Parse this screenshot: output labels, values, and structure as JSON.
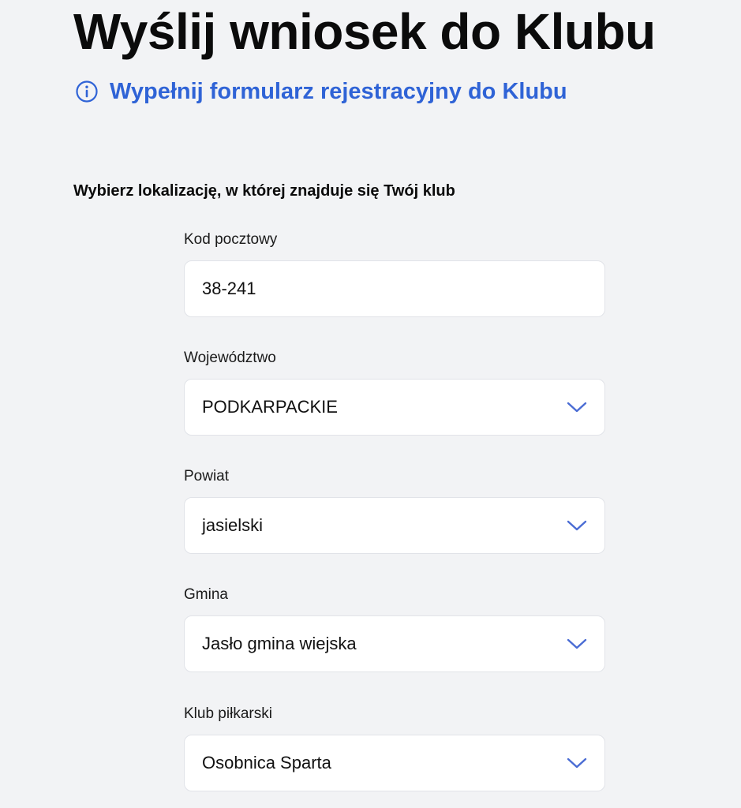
{
  "page": {
    "title": "Wyślij wniosek do Klubu",
    "info_link": "Wypełnij formularz rejestracyjny do Klubu",
    "section_heading": "Wybierz lokalizację, w której znajduje się Twój klub"
  },
  "form": {
    "postal_code": {
      "label": "Kod pocztowy",
      "value": "38-241"
    },
    "voivodeship": {
      "label": "Województwo",
      "value": "PODKARPACKIE"
    },
    "county": {
      "label": "Powiat",
      "value": "jasielski"
    },
    "municipality": {
      "label": "Gmina",
      "value": "Jasło gmina wiejska"
    },
    "club": {
      "label": "Klub piłkarski",
      "value": "Osobnica Sparta"
    }
  },
  "colors": {
    "background": "#f2f3f5",
    "accent": "#2f63d6",
    "chevron": "#4a6cd4",
    "field_background": "#ffffff"
  },
  "icons": {
    "info": "info-circle-icon",
    "dropdown": "chevron-down-icon"
  }
}
